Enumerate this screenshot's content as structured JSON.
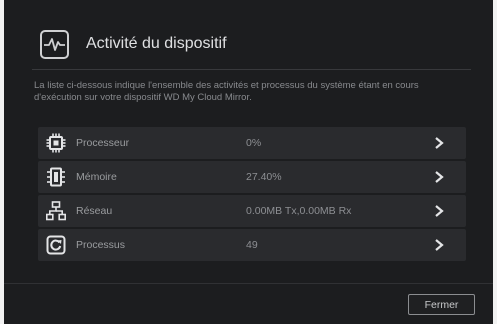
{
  "dialog": {
    "title": "Activité du dispositif",
    "description": "La liste ci-dessous indique l'ensemble des activités et processus du système étant en cours d'exécution sur votre dispositif WD My Cloud Mirror."
  },
  "rows": [
    {
      "label": "Processeur",
      "value": "0%",
      "icon": "cpu-icon"
    },
    {
      "label": "Mémoire",
      "value": "27.40%",
      "icon": "memory-icon"
    },
    {
      "label": "Réseau",
      "value": "0.00MB Tx,0.00MB Rx",
      "icon": "network-icon"
    },
    {
      "label": "Processus",
      "value": "49",
      "icon": "process-icon"
    }
  ],
  "footer": {
    "close_label": "Fermer"
  },
  "colors": {
    "dialog_bg": "#1c1d1f",
    "row_bg": "#2a2b2e",
    "icon": "#e4e5e7"
  }
}
